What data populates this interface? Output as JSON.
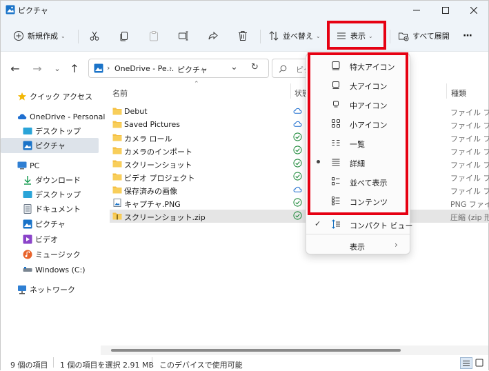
{
  "window": {
    "title": "ピクチャ"
  },
  "toolbar": {
    "new_label": "新規作成",
    "sort_label": "並べ替え",
    "view_label": "表示",
    "expand_all_label": "すべて展開",
    "more_label": "···"
  },
  "address": {
    "path_root": "OneDrive - Pe...",
    "path_current": "ピクチャ",
    "search_placeholder": "ピク"
  },
  "sidebar": {
    "items": [
      {
        "label": "クイック アクセス",
        "icon": "star-icon"
      },
      {
        "label": "OneDrive - Personal",
        "icon": "cloud-icon"
      },
      {
        "label": "デスクトップ",
        "icon": "desktop-icon"
      },
      {
        "label": "ピクチャ",
        "icon": "pictures-icon"
      },
      {
        "label": "PC",
        "icon": "pc-icon"
      },
      {
        "label": "ダウンロード",
        "icon": "download-icon"
      },
      {
        "label": "デスクトップ",
        "icon": "desktop-icon"
      },
      {
        "label": "ドキュメント",
        "icon": "document-icon"
      },
      {
        "label": "ピクチャ",
        "icon": "pictures-icon"
      },
      {
        "label": "ビデオ",
        "icon": "video-icon"
      },
      {
        "label": "ミュージック",
        "icon": "music-icon"
      },
      {
        "label": "Windows (C:)",
        "icon": "drive-icon"
      },
      {
        "label": "ネットワーク",
        "icon": "network-icon"
      }
    ]
  },
  "columns": {
    "name": "名前",
    "status": "状態",
    "type": "種類"
  },
  "files": [
    {
      "name": "Debut",
      "kind": "folder",
      "status": "cloud",
      "type": "ファイル フォル"
    },
    {
      "name": "Saved Pictures",
      "kind": "folder",
      "status": "cloud",
      "type": "ファイル フォル"
    },
    {
      "name": "カメラ ロール",
      "kind": "folder",
      "status": "check",
      "type": "ファイル フォル"
    },
    {
      "name": "カメラのインポート",
      "kind": "folder",
      "status": "check",
      "type": "ファイル フォル"
    },
    {
      "name": "スクリーンショット",
      "kind": "folder",
      "status": "check",
      "type": "ファイル フォル"
    },
    {
      "name": "ビデオ プロジェクト",
      "kind": "folder",
      "status": "check",
      "type": "ファイル フォル"
    },
    {
      "name": "保存済みの画像",
      "kind": "folder",
      "status": "cloud",
      "type": "ファイル フォル"
    },
    {
      "name": "キャプチャ.PNG",
      "kind": "image",
      "status": "check",
      "type": "PNG ファイル"
    },
    {
      "name": "スクリーンショット.zip",
      "kind": "zip",
      "status": "check",
      "type": "圧縮 (zip 形"
    }
  ],
  "view_menu": {
    "items": [
      {
        "label": "特大アイコン",
        "icon": "extra-large-icons-icon"
      },
      {
        "label": "大アイコン",
        "icon": "large-icons-icon"
      },
      {
        "label": "中アイコン",
        "icon": "medium-icons-icon"
      },
      {
        "label": "小アイコン",
        "icon": "small-icons-icon"
      },
      {
        "label": "一覧",
        "icon": "list-icon"
      },
      {
        "label": "詳細",
        "icon": "details-icon",
        "selected": true
      },
      {
        "label": "並べて表示",
        "icon": "tiles-icon"
      },
      {
        "label": "コンテンツ",
        "icon": "content-icon"
      },
      {
        "label": "コンパクト ビュー",
        "icon": "compact-view-icon",
        "checked": true
      },
      {
        "label": "表示",
        "icon": "",
        "submenu": true
      }
    ]
  },
  "statusbar": {
    "item_count": "9 個の項目",
    "selection": "1 個の項目を選択  2.91 MB",
    "availability": "このデバイスで使用可能"
  },
  "colors": {
    "highlight_red": "#e60012",
    "folder_yellow": "#f5c044",
    "accent_blue": "#0f6cbd",
    "check_green": "#1f8a3b"
  }
}
